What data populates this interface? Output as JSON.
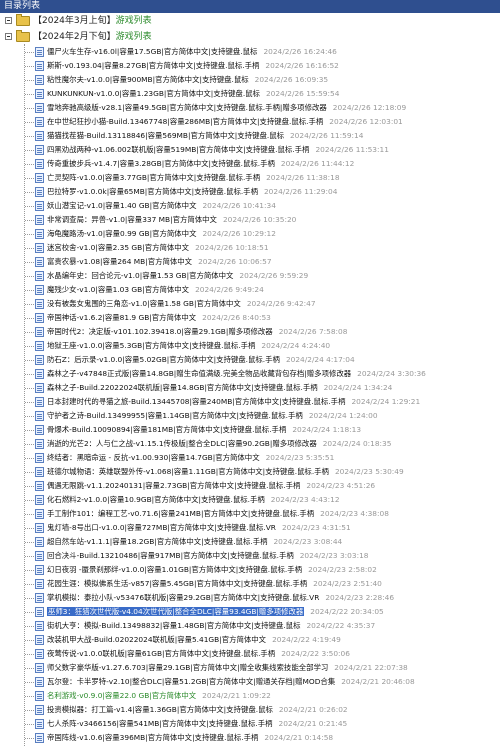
{
  "window": {
    "title": "目录列表"
  },
  "folders": [
    {
      "label": "【2024年3月上旬】",
      "suffix": "游戏列表"
    },
    {
      "label": "【2024年2月下旬】",
      "suffix": "游戏列表"
    }
  ],
  "games": [
    {
      "name": "僵尸火车生存-v16.0l|容量17.5GB|官方简体中文|支持键盘.鼠标",
      "date": "2024/2/26 16:24:46"
    },
    {
      "name": "斯斯-v0.193.04|容量8.27GB|官方简体中文|支持键盘.鼠标.手柄",
      "date": "2024/2/26 16:16:52"
    },
    {
      "name": "粘性魔尔夫-v1.0.0|容量900MB|官方简体中文|支持键盘.鼠标",
      "date": "2024/2/26 16:09:35"
    },
    {
      "name": "KUNKUNKUN-v1.0.0|容量1.23GB|官方简体中文|支持键盘.鼠标",
      "date": "2024/2/26 15:59:54"
    },
    {
      "name": "雪地奔驰高级版-v28.1|容量49.5GB|官方简体中文|支持键盘.鼠标.手柄|赠多项修改器",
      "date": "2024/2/26 12:18:09"
    },
    {
      "name": "在中世纪狂抄小猫-Build.13467748|容量286MB|官方简体中文|支持键盘.鼠标.手柄",
      "date": "2024/2/26 12:03:01"
    },
    {
      "name": "猫猫找茬猫-Build.13118846|容量569MB|官方简体中文|支持键盘.鼠标",
      "date": "2024/2/26 11:59:14"
    },
    {
      "name": "四黑劝战两种-v1.06.002联机版|容量519MB|官方简体中文|支持键盘.鼠标.手柄",
      "date": "2024/2/26 11:53:11"
    },
    {
      "name": "传奇重披步兵-v1.4.7|容量3.28GB|官方简体中文|支持键盘.鼠标.手柄",
      "date": "2024/2/26 11:44:12"
    },
    {
      "name": "亡灵契阵-v1.0.0|容量3.77GB|官方简体中文|支持键盘.鼠标.手柄",
      "date": "2024/2/26 11:38:18"
    },
    {
      "name": "巴拉特罗-v1.0.0k|容量65MB|官方简体中文|支持键盘.鼠标.手柄",
      "date": "2024/2/26 11:29:04"
    },
    {
      "name": "妖山潜宝记-v1.0|容量1.40 GB|官方简体中文",
      "date": "2024/2/26 10:41:34"
    },
    {
      "name": "非常调查局：异兽-v1.0|容量337 MB|官方简体中文",
      "date": "2024/2/26 10:35:20"
    },
    {
      "name": "海龟魔路汤-v1.0|容量0.99 GB|官方简体中文",
      "date": "2024/2/26 10:29:12"
    },
    {
      "name": "迷宫校舍-v1.0|容量2.35 GB|官方简体中文",
      "date": "2024/2/26 10:18:51"
    },
    {
      "name": "富贵农暴-v1.08|容量264 MB|官方简体中文",
      "date": "2024/2/26 10:06:57"
    },
    {
      "name": "水晶编年史：回合论元-v1.0|容量1.53 GB|官方简体中文",
      "date": "2024/2/26 9:59:29"
    },
    {
      "name": "魔残少女-v1.0|容量1.03 GB|官方简体中文",
      "date": "2024/2/26 9:49:24"
    },
    {
      "name": "没有被轰女鬼围的三角恋-v1.0|容量1.58 GB|官方简体中文",
      "date": "2024/2/26 9:42:47"
    },
    {
      "name": "帝国神话-v1.6.2|容量81.9 GB|官方简体中文",
      "date": "2024/2/26 8:40:53"
    },
    {
      "name": "帝国时代2：决定版-v101.102.39418.0|容量29.1GB|赠多项修改器",
      "date": "2024/2/26 7:58:08"
    },
    {
      "name": "地狱王座-v1.0.0|容量5.3GB|官方简体中文|支持键盘.鼠标.手柄",
      "date": "2024/2/24 4:24:40"
    },
    {
      "name": "防石Z：后示录-v1.0.0|容量5.02GB|官方简体中文|支持键盘.鼠标.手柄",
      "date": "2024/2/24 4:17:04"
    },
    {
      "name": "森林之子-v47848正式版|容量14.8GB|赠生命值满级.完美全物品收藏背包存档|赠多项修改器",
      "date": "2024/2/24 3:30:36"
    },
    {
      "name": "森林之子-Build.22022024联机版|容量14.8GB|官方简体中文|支持键盘.鼠标.手柄",
      "date": "2024/2/24 1:34:24"
    },
    {
      "name": "日本封建时代的寻猫之旅-Build.13445708|容量240MB|官方简体中文|支持键盘.鼠标.手柄",
      "date": "2024/2/24 1:29:21"
    },
    {
      "name": "守护者之诗-Build.13499955|容量1.14GB|官方简体中文|支持键盘.鼠标.手柄",
      "date": "2024/2/24 1:24:00"
    },
    {
      "name": "骨爆术-Build.10090894|容量181MB|官方简体中文|支持键盘.鼠标.手柄",
      "date": "2024/2/24 1:18:13"
    },
    {
      "name": "消逝的光芒2：人与仁之战-v1.15.1传极版|整合全DLC|容量90.2GB|赠多项修改器",
      "date": "2024/2/24 0:18:35"
    },
    {
      "name": "终结者：黑暗命运 - 反抗-v1.00.930|容量14.7GB|官方简体中文",
      "date": "2024/2/23 5:35:51"
    },
    {
      "name": "班德尔城物语：英雄联盟外传-v1.068|容量1.11GB|官方简体中文|支持键盘.鼠标.手柄",
      "date": "2024/2/23 5:30:49"
    },
    {
      "name": "偶遇无限跳-v1.1.20240131|容量2.73GB|官方简体中文|支持键盘.鼠标.手柄",
      "date": "2024/2/23 4:51:26"
    },
    {
      "name": "化石燃料2-v1.0.0|容量10.9GB|官方简体中文|支持键盘.鼠标.手柄",
      "date": "2024/2/23 4:43:12"
    },
    {
      "name": "手工制作101：编程工艺-v0.71.6|容量241MB|官方简体中文|支持键盘.鼠标.手柄",
      "date": "2024/2/23 4:38:08"
    },
    {
      "name": "鬼灯墙-8号出口-v1.0.0|容量727MB|官方简体中文|支持键盘.鼠标.VR",
      "date": "2024/2/23 4:31:51"
    },
    {
      "name": "超自然车站-v1.1.1|容量18.2GB|官方简体中文|支持键盘.鼠标.手柄",
      "date": "2024/2/23 3:08:44"
    },
    {
      "name": "回合决斗-Build.13210486|容量917MB|官方简体中文|支持键盘.鼠标.手柄",
      "date": "2024/2/23 3:03:18"
    },
    {
      "name": "幻日夜羽 -蜃景刹那绊-v1.0.0|容量1.01GB|官方简体中文|支持键盘.鼠标.手柄",
      "date": "2024/2/23 2:58:02"
    },
    {
      "name": "花园生涯：模拟佛系生活-v857|容量5.45GB|官方简体中文|支持键盘.鼠标.手柄",
      "date": "2024/2/23 2:51:40"
    },
    {
      "name": "掌机模拟：泰拉小队-v53476联机版|容量29.2GB|官方简体中文|支持键盘.鼠标.VR",
      "date": "2024/2/23 2:28:46"
    },
    {
      "name": "巫师3：狂猎次世代版-v4.04次世代版|整合全DLC|容量93.4GB|赠多项修改器",
      "date": "2024/2/22 20:34:05",
      "green": true,
      "selected": true
    },
    {
      "name": "街机大亨：模拟-Build.13498832|容量1.48GB|官方简体中文|支持键盘.鼠标",
      "date": "2024/2/22 4:35:37"
    },
    {
      "name": "改装机甲大战-Build.02022024联机版|容量5.41GB|官方简体中文",
      "date": "2024/2/22 4:19:49"
    },
    {
      "name": "夜莺传说-v1.0.0联机版|容量61GB|官方简体中文|支持键盘.鼠标.手柄",
      "date": "2024/2/22 3:50:06"
    },
    {
      "name": "师父数字豪华版-v1.27.6.703|容量29.1GB|官方简体中文|赠全收集线索技能全部学习",
      "date": "2024/2/21 22:07:38"
    },
    {
      "name": "瓦尔登：卡半罗特-v2.10|整合DLC|容量51.2GB|官方简体中文|赠通关存档|赠MOD合集",
      "date": "2024/2/21 20:46:08"
    },
    {
      "name": "名利游戏-v0.9.0|容量22.0 GB|官方简体中文",
      "date": "2024/2/21 1:09:22",
      "green": true
    },
    {
      "name": "投资模拟器：打工篇-v1.4|容量1.36GB|官方简体中文|支持键盘.鼠标",
      "date": "2024/2/21 0:26:02"
    },
    {
      "name": "七人杀阵-v3466156|容量541MB|官方简体中文|支持键盘.鼠标.手柄",
      "date": "2024/2/21 0:21:45"
    },
    {
      "name": "帝国阵线-v1.0.6|容量396MB|官方简体中文|支持键盘.鼠标.手柄",
      "date": "2024/2/21 0:14:58"
    }
  ]
}
